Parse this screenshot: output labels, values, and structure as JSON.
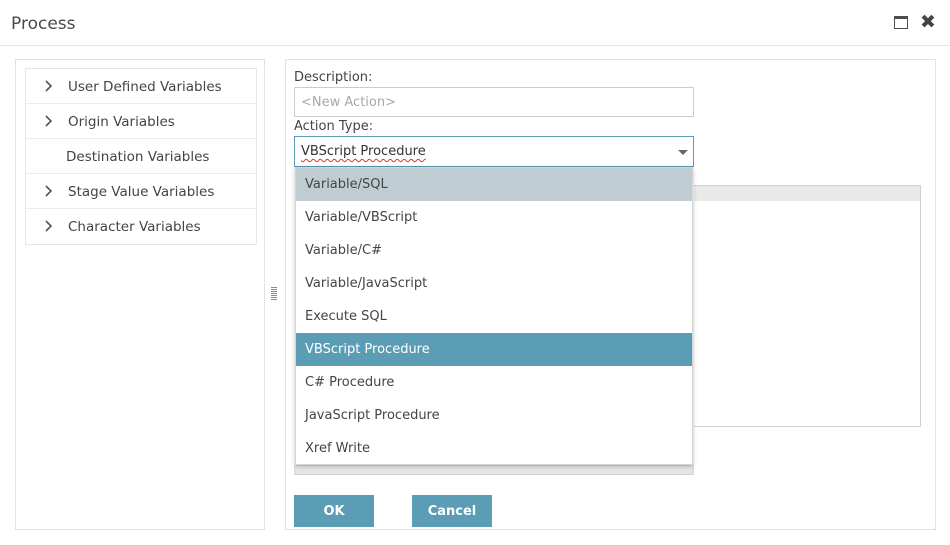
{
  "window": {
    "title": "Process",
    "maximize_icon": "window-maximize-icon",
    "close_icon": "close-icon",
    "close_glyph": "✖"
  },
  "variables_tree": {
    "items": [
      {
        "label": "User Defined Variables",
        "expandable": true
      },
      {
        "label": "Origin Variables",
        "expandable": true
      },
      {
        "label": "Destination Variables",
        "expandable": false
      },
      {
        "label": "Stage Value Variables",
        "expandable": true
      },
      {
        "label": "Character Variables",
        "expandable": true
      }
    ]
  },
  "form": {
    "description_label": "Description:",
    "description_value": "",
    "description_placeholder": "<New Action>",
    "action_type_label": "Action Type:",
    "action_type_value": "VBScript Procedure"
  },
  "dropdown": {
    "options": [
      "Variable/SQL",
      "Variable/VBScript",
      "Variable/C#",
      "Variable/JavaScript",
      "Execute SQL",
      "VBScript Procedure",
      "C# Procedure",
      "JavaScript Procedure",
      "Xref Write"
    ],
    "hovered_index": 0,
    "selected_index": 5
  },
  "buttons": {
    "ok_label": "OK",
    "cancel_label": "Cancel"
  },
  "colors": {
    "accent": "#5b9db5",
    "hover": "#bfcdd2"
  }
}
